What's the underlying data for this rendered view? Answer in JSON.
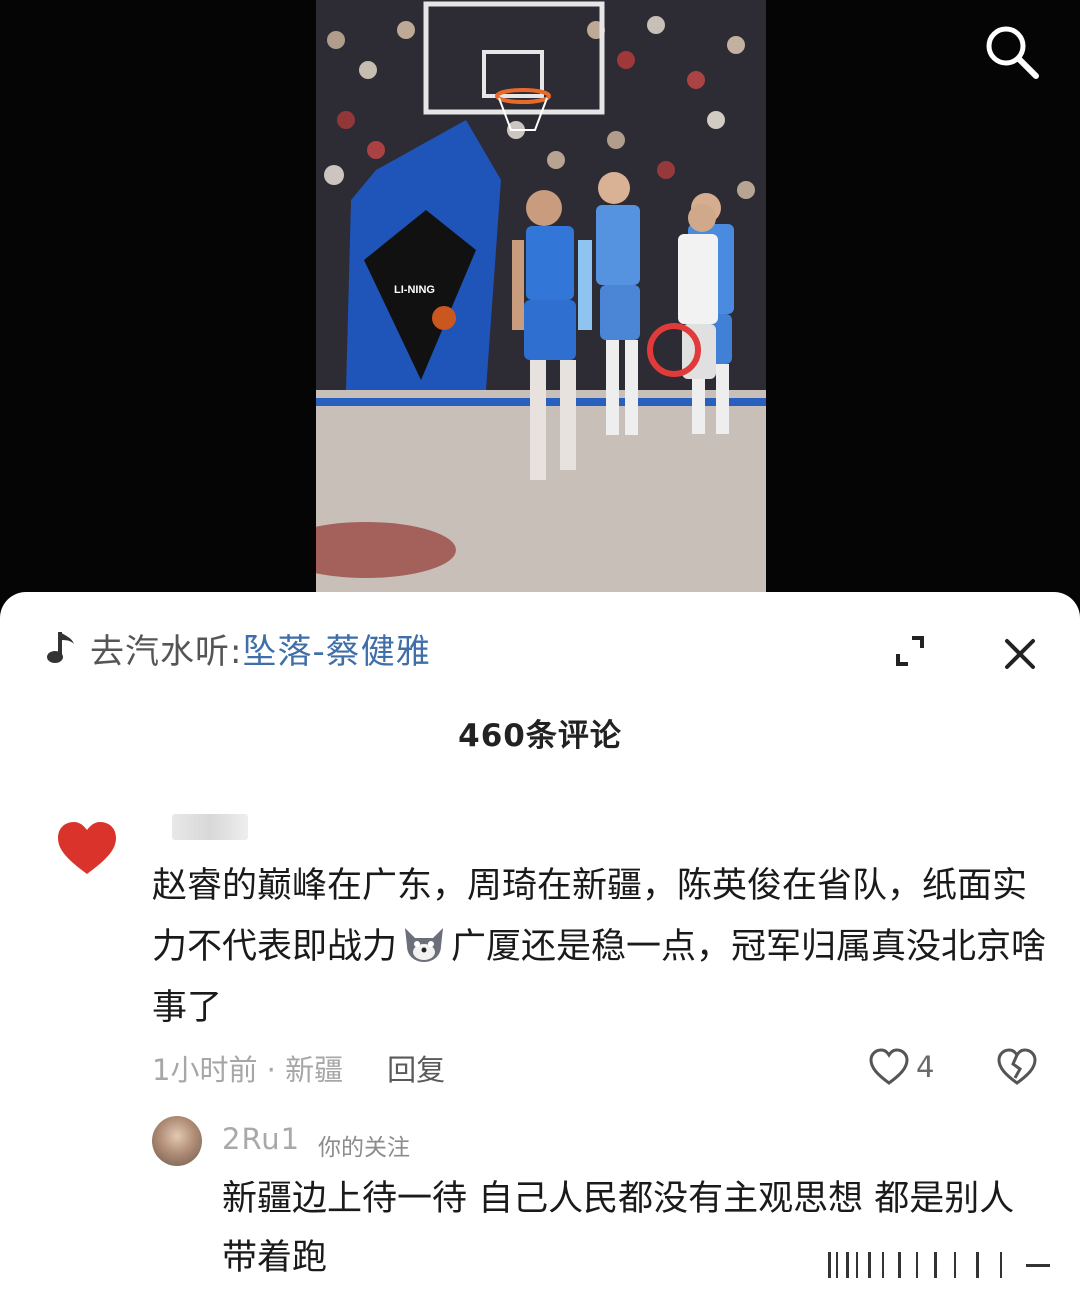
{
  "music": {
    "prefix": "去汽水听:",
    "song": "坠落-蔡健雅"
  },
  "comments": {
    "count_label": "460条评论"
  },
  "comment": {
    "text": "赵睿的巅峰在广东，周琦在新疆，陈英俊在省队，纸面实力不代表即战力",
    "text_after_emoji": "广厦还是稳一点，冠军归属真没北京啥事了",
    "meta": "1小时前 · 新疆",
    "reply_label": "回复",
    "like_count": "4"
  },
  "reply": {
    "username": "2Ru1",
    "badge": "你的关注",
    "text": "新疆边上待一待 自己人民都没有主观思想 都是别人带着跑"
  },
  "icons": {
    "search": "search-icon",
    "music": "music-note-icon",
    "expand": "expand-icon",
    "close": "close-icon",
    "like": "heart-outline-icon",
    "dislike": "broken-heart-icon",
    "avatar": "red-heart-avatar",
    "emoji": "wolf-emoji"
  },
  "colors": {
    "song_link": "#3f6ea8",
    "avatar_heart": "#d9332c"
  }
}
